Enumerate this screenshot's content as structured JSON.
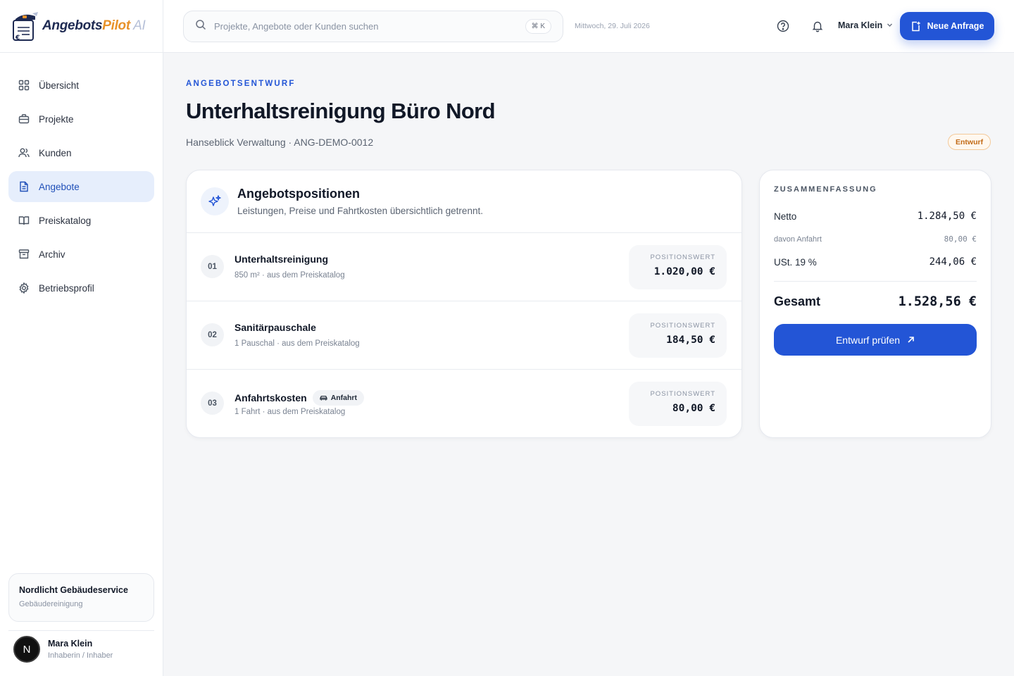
{
  "brand": {
    "part1": "Angebots",
    "part2": "Pilot",
    "part3": " AI",
    "primary_color": "#2355d6",
    "accent_color": "#e8922a"
  },
  "sidebar": {
    "items": [
      {
        "label": "Übersicht",
        "icon": "grid-icon"
      },
      {
        "label": "Projekte",
        "icon": "briefcase-icon"
      },
      {
        "label": "Kunden",
        "icon": "users-icon"
      },
      {
        "label": "Angebote",
        "icon": "document-icon",
        "active": true
      },
      {
        "label": "Preiskatalog",
        "icon": "book-icon"
      },
      {
        "label": "Archiv",
        "icon": "archive-icon"
      },
      {
        "label": "Betriebsprofil",
        "icon": "gear-icon"
      }
    ],
    "company": {
      "name": "Nordlicht Gebäudeservice",
      "type": "Gebäudereinigung"
    },
    "user": {
      "initial": "N",
      "name": "Mara Klein",
      "role": "Inhaberin / Inhaber"
    }
  },
  "header": {
    "search_placeholder": "Projekte, Angebote oder Kunden suchen",
    "shortcut": "⌘ K",
    "date": "Mittwoch, 29. Juli 2026",
    "user_name": "Mara Klein",
    "cta_label": "Neue Anfrage"
  },
  "page": {
    "eyebrow": "ANGEBOTSENTWURF",
    "title": "Unterhaltsreinigung Büro Nord",
    "subtitle": "Hanseblick Verwaltung · ANG-DEMO-0012",
    "status": "Entwurf"
  },
  "positions": {
    "title": "Angebotspositionen",
    "subtitle": "Leistungen, Preise und Fahrtkosten übersichtlich getrennt.",
    "value_label": "POSITIONSWERT",
    "items": [
      {
        "num": "01",
        "name": "Unterhaltsreinigung",
        "meta": "850 m² · aus dem Preiskatalog",
        "value": "1.020,00 €",
        "tag": ""
      },
      {
        "num": "02",
        "name": "Sanitärpauschale",
        "meta": "1 Pauschal · aus dem Preiskatalog",
        "value": "184,50 €",
        "tag": ""
      },
      {
        "num": "03",
        "name": "Anfahrtskosten",
        "meta": "1 Fahrt · aus dem Preiskatalog",
        "value": "80,00 €",
        "tag": "Anfahrt"
      }
    ]
  },
  "summary": {
    "eyebrow": "ZUSAMMENFASSUNG",
    "netto_label": "Netto",
    "netto_value": "1.284,50 €",
    "anfahrt_label": "davon Anfahrt",
    "anfahrt_value": "80,00 €",
    "ust_label": "USt. 19 %",
    "ust_value": "244,06 €",
    "total_label": "Gesamt",
    "total_value": "1.528,56 €",
    "button_label": "Entwurf prüfen"
  }
}
